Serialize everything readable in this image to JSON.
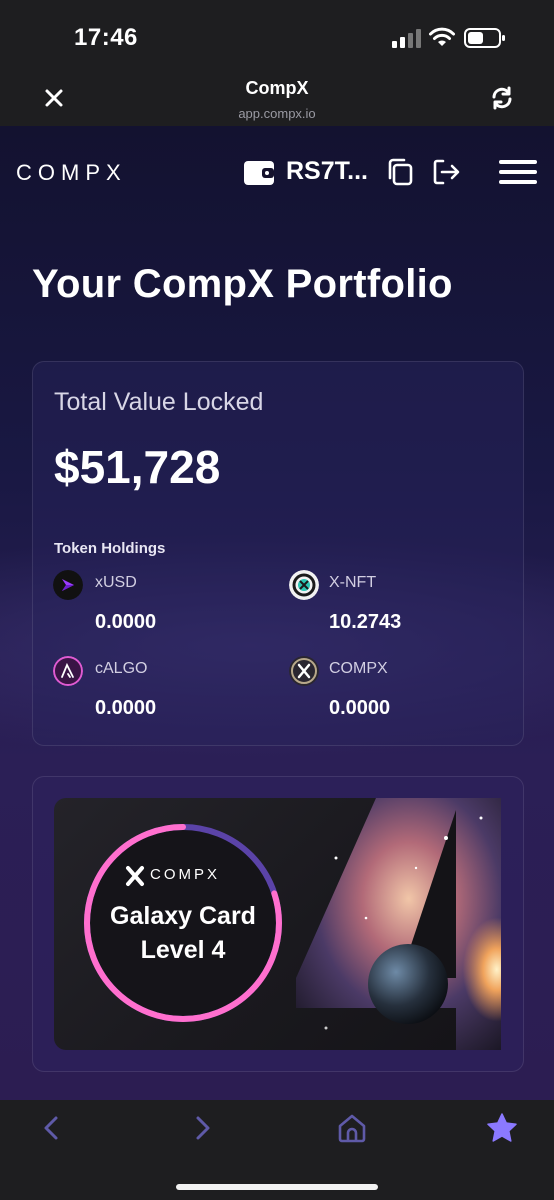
{
  "status_bar": {
    "time": "17:46"
  },
  "browser": {
    "title": "CompX",
    "url": "app.compx.io"
  },
  "header": {
    "logo_text": "COMPX",
    "wallet_address": "RS7T...",
    "icons": [
      "wallet-icon",
      "copy-icon",
      "logout-icon",
      "menu-icon"
    ]
  },
  "page_title": "Your CompX Portfolio",
  "portfolio": {
    "tvl_label": "Total Value Locked",
    "tvl_value": "$51,728",
    "holdings_label": "Token Holdings",
    "tokens": [
      {
        "name": "xUSD",
        "amount": "0.0000",
        "icon": "xusd-token-icon",
        "color": "#8b2cf5"
      },
      {
        "name": "X-NFT",
        "amount": "10.2743",
        "icon": "xnft-token-icon",
        "color": "#2cc7b4"
      },
      {
        "name": "cALGO",
        "amount": "0.0000",
        "icon": "calgo-token-icon",
        "color": "#e05bd2"
      },
      {
        "name": "COMPX",
        "amount": "0.0000",
        "icon": "compx-token-icon",
        "color": "#b7a88a"
      }
    ]
  },
  "galaxy_card": {
    "brand": "COMPX",
    "line1": "Galaxy Card",
    "line2": "Level 4",
    "level_progress": 0.8,
    "ring_color": "#ff6fce",
    "ring_track_color": "#5b43a8"
  },
  "toolbar": {
    "icons": [
      "back-icon",
      "forward-icon",
      "home-icon",
      "favorites-star-icon"
    ],
    "accent": "#8b79ff"
  }
}
